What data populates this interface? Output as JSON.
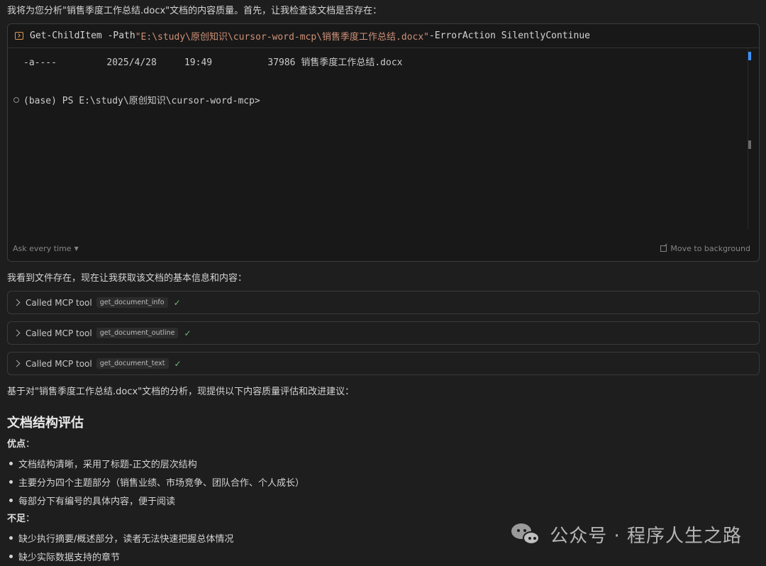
{
  "intro": "我将为您分析\"销售季度工作总结.docx\"文档的内容质量。首先，让我检查该文档是否存在：",
  "terminal": {
    "cmd_start": "Get-ChildItem -Path ",
    "cmd_path": "\"E:\\study\\原创知识\\cursor-word-mcp\\销售季度工作总结.docx\"",
    "cmd_end": " -ErrorAction SilentlyContinue",
    "output": "-a----         2025/4/28     19:49          37986 销售季度工作总结.docx",
    "prompt": "(base) PS E:\\study\\原创知识\\cursor-word-mcp>",
    "ask_label": "Ask every time",
    "move_label": "Move to background"
  },
  "after_terminal": "我看到文件存在，现在让我获取该文档的基本信息和内容：",
  "tools": [
    {
      "label": "Called MCP tool",
      "name": "get_document_info"
    },
    {
      "label": "Called MCP tool",
      "name": "get_document_outline"
    },
    {
      "label": "Called MCP tool",
      "name": "get_document_text"
    }
  ],
  "analysis_intro": "基于对\"销售季度工作总结.docx\"文档的分析，现提供以下内容质量评估和改进建议：",
  "section_title": "文档结构评估",
  "pros": {
    "label": "优点",
    "items": [
      "文档结构清晰，采用了标题-正文的层次结构",
      "主要分为四个主题部分（销售业绩、市场竞争、团队合作、个人成长）",
      "每部分下有编号的具体内容，便于阅读"
    ]
  },
  "cons": {
    "label": "不足",
    "items": [
      "缺少执行摘要/概述部分，读者无法快速把握总体情况",
      "缺少实际数据支持的章节"
    ]
  },
  "watermark": "公众号 · 程序人生之路"
}
